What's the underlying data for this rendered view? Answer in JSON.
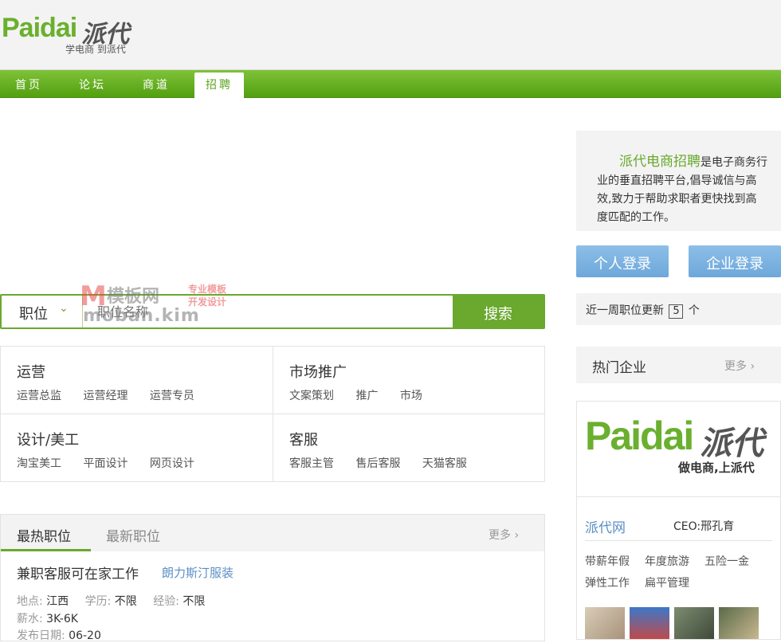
{
  "header": {
    "logo_en": "Paidai",
    "logo_cn": "派代",
    "slogan": "学电商 到派代"
  },
  "nav": {
    "items": [
      "首页",
      "论坛",
      "商道",
      "招聘"
    ],
    "active": "招聘"
  },
  "search": {
    "type_label": "职位",
    "placeholder": "职位名称",
    "button_label": "搜索"
  },
  "watermark": {
    "logo": "M",
    "name": "模板网",
    "tag1": "专业模板",
    "tag2": "开发设计",
    "url": "moban.kim"
  },
  "categories": [
    {
      "title": "运营",
      "links": [
        "运营总监",
        "运营经理",
        "运营专员"
      ]
    },
    {
      "title": "市场推广",
      "links": [
        "文案策划",
        "推广",
        "市场"
      ]
    },
    {
      "title": "设计/美工",
      "links": [
        "淘宝美工",
        "平面设计",
        "网页设计"
      ]
    },
    {
      "title": "客服",
      "links": [
        "客服主管",
        "售后客服",
        "天猫客服"
      ]
    }
  ],
  "jobs": {
    "tab_hot": "最热职位",
    "tab_new": "最新职位",
    "more": "更多 ›",
    "job": {
      "title": "兼职客服可在家工作",
      "company": "朗力斯汀服装",
      "location_label": "地点:",
      "location": "江西",
      "education_label": "学历:",
      "education": "不限",
      "experience_label": "经验:",
      "experience": "不限",
      "salary_label": "薪水:",
      "salary": "3K-6K",
      "date_label": "发布日期:",
      "date": "06-20"
    }
  },
  "intro": {
    "brand": "派代电商招聘",
    "text_first": "是电子商务行",
    "line2": "业的垂直招聘平台,倡导诚信与高",
    "line3": "效,致力于帮助求职者更快找到高",
    "line4": "度匹配的工作。"
  },
  "login": {
    "personal": "个人登录",
    "company": "企业登录"
  },
  "update": {
    "prefix": "近一周职位更新",
    "count": "5",
    "suffix": "个"
  },
  "hot_companies": {
    "title": "热门企业",
    "more": "更多 ›",
    "card": {
      "logo_en": "Paidai",
      "logo_cn": "派代",
      "logo_slogan": "做电商,上派代",
      "name": "派代网",
      "ceo": "CEO:邢孔育",
      "perks": [
        "带薪年假",
        "年度旅游",
        "五险一金",
        "弹性工作",
        "扁平管理"
      ]
    }
  },
  "colors": {
    "brand_green": "#6aa82e",
    "nav_green": "#5ba51d",
    "link_blue": "#5b8ec4",
    "login_blue": "#7ab3e0"
  }
}
